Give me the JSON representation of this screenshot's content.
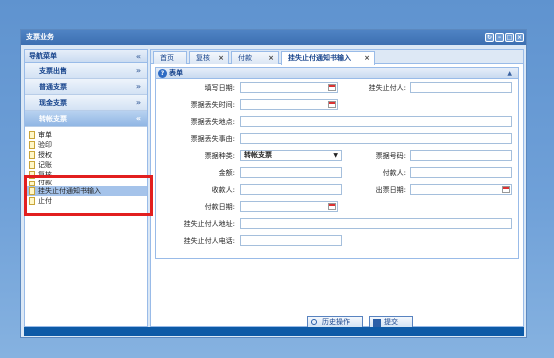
{
  "window": {
    "title": "支票业务"
  },
  "sidebar": {
    "header": "导航菜单",
    "header_chevron": "«",
    "sections": [
      {
        "label": "支票出售",
        "chevron": "»",
        "active": false
      },
      {
        "label": "普通支票",
        "chevron": "»",
        "active": false
      },
      {
        "label": "现金支票",
        "chevron": "»",
        "active": false
      },
      {
        "label": "转帐支票",
        "chevron": "«",
        "active": true
      }
    ],
    "items": [
      {
        "label": "审单"
      },
      {
        "label": "验印"
      },
      {
        "label": "授权"
      },
      {
        "label": "记账"
      },
      {
        "label": "复核"
      },
      {
        "label": "付款"
      },
      {
        "label": "挂失止付通知书输入"
      },
      {
        "label": "止付"
      }
    ]
  },
  "tabs": [
    {
      "label": "首页",
      "closable": false
    },
    {
      "label": "复核",
      "closable": true
    },
    {
      "label": "付款",
      "closable": true
    },
    {
      "label": "挂失止付通知书输入",
      "closable": true,
      "active": true
    }
  ],
  "form": {
    "title": "表单",
    "fill_date_label": "填写日期:",
    "loss_payer_label": "挂失止付人:",
    "loss_time_label": "票据丢失时间:",
    "loss_place_label": "票据丢失地点:",
    "loss_reason_label": "票据丢失事由:",
    "bill_type_label": "票据种类:",
    "bill_type_value": "转帐支票",
    "bill_no_label": "票据号码:",
    "amount_label": "金额:",
    "payer_label": "付款人:",
    "payee_label": "收款人:",
    "issue_date_label": "出票日期:",
    "pay_date_label": "付款日期:",
    "loss_payer_addr_label": "挂失止付人地址:",
    "loss_payer_phone_label": "挂失止付人电话:"
  },
  "buttons": {
    "history": "历史操作",
    "submit": "提交"
  },
  "colors": {
    "highlight_box": "#e21f1f",
    "status_bar": "#0d5aa7"
  }
}
